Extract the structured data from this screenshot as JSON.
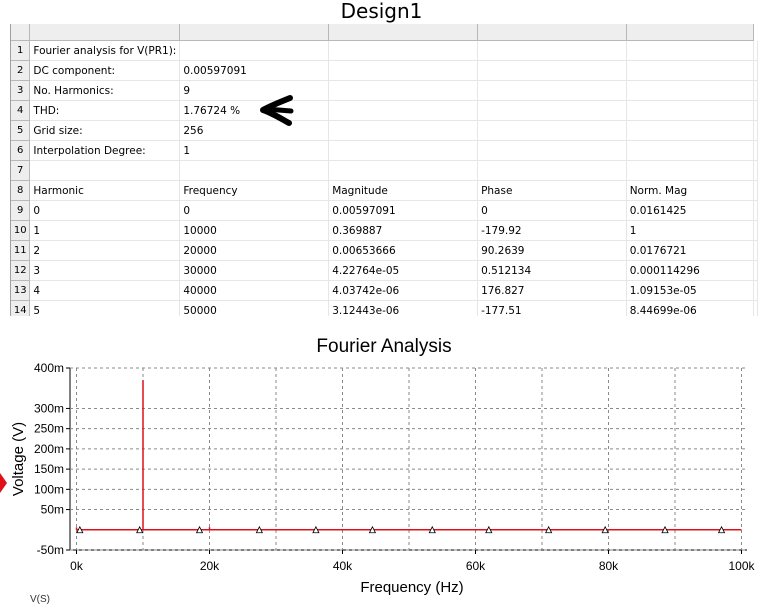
{
  "window": {
    "title": "Design1"
  },
  "grid": {
    "row_numbers": [
      "1",
      "2",
      "3",
      "4",
      "5",
      "6",
      "7",
      "8",
      "9",
      "10",
      "11",
      "12",
      "13",
      "14"
    ],
    "rows": [
      [
        "Fourier analysis for V(PR1):",
        "",
        "",
        "",
        ""
      ],
      [
        "DC component:",
        "0.00597091",
        "",
        "",
        ""
      ],
      [
        "No. Harmonics:",
        "9",
        "",
        "",
        ""
      ],
      [
        "THD:",
        "1.76724 %",
        "",
        "",
        ""
      ],
      [
        "Grid size:",
        "256",
        "",
        "",
        ""
      ],
      [
        "Interpolation Degree:",
        "1",
        "",
        "",
        ""
      ],
      [
        "",
        "",
        "",
        "",
        ""
      ],
      [
        "Harmonic",
        "Frequency",
        "Magnitude",
        "Phase",
        "Norm. Mag"
      ],
      [
        "0",
        "0",
        "0.00597091",
        "0",
        "0.0161425"
      ],
      [
        "1",
        "10000",
        "0.369887",
        "-179.92",
        "1"
      ],
      [
        "2",
        "20000",
        "0.00653666",
        "90.2639",
        "0.0176721"
      ],
      [
        "3",
        "30000",
        "4.22764e-05",
        "0.512134",
        "0.000114296"
      ],
      [
        "4",
        "40000",
        "4.03742e-06",
        "176.827",
        "1.09153e-05"
      ],
      [
        "5",
        "50000",
        "3.12443e-06",
        "-177.51",
        "8.44699e-06"
      ]
    ]
  },
  "chart_data": {
    "type": "bar",
    "title": "Fourier Analysis",
    "xlabel": "Frequency (Hz)",
    "ylabel": "Voltage (V)",
    "xlim": [
      0,
      100000
    ],
    "ylim": [
      -50,
      400
    ],
    "y_unit": "mV",
    "x_ticks": [
      {
        "value": 0,
        "label": "0k"
      },
      {
        "value": 20000,
        "label": "20k"
      },
      {
        "value": 40000,
        "label": "40k"
      },
      {
        "value": 60000,
        "label": "60k"
      },
      {
        "value": 80000,
        "label": "80k"
      },
      {
        "value": 100000,
        "label": "100k"
      }
    ],
    "y_ticks": [
      {
        "value": -50,
        "label": "-50m"
      },
      {
        "value": 50,
        "label": "50m"
      },
      {
        "value": 100,
        "label": "100m"
      },
      {
        "value": 150,
        "label": "150m"
      },
      {
        "value": 200,
        "label": "200m"
      },
      {
        "value": 250,
        "label": "250m"
      },
      {
        "value": 300,
        "label": "300m"
      },
      {
        "value": 400,
        "label": "400m"
      }
    ],
    "grid": true,
    "series": [
      {
        "color": "#e0101a",
        "x": [
          0,
          10000,
          20000,
          30000,
          40000,
          50000,
          60000,
          70000,
          80000,
          90000,
          100000
        ],
        "values": [
          5.97091,
          369.887,
          6.53666,
          0.0422764,
          0.00403742,
          0.00312443,
          0,
          0,
          0,
          0,
          0
        ]
      }
    ],
    "marker_x": [
      500,
      9500,
      18500,
      27500,
      36000,
      44500,
      53500,
      62000,
      71000,
      79500,
      88500,
      97000
    ]
  },
  "bottom_text": "V(S)"
}
